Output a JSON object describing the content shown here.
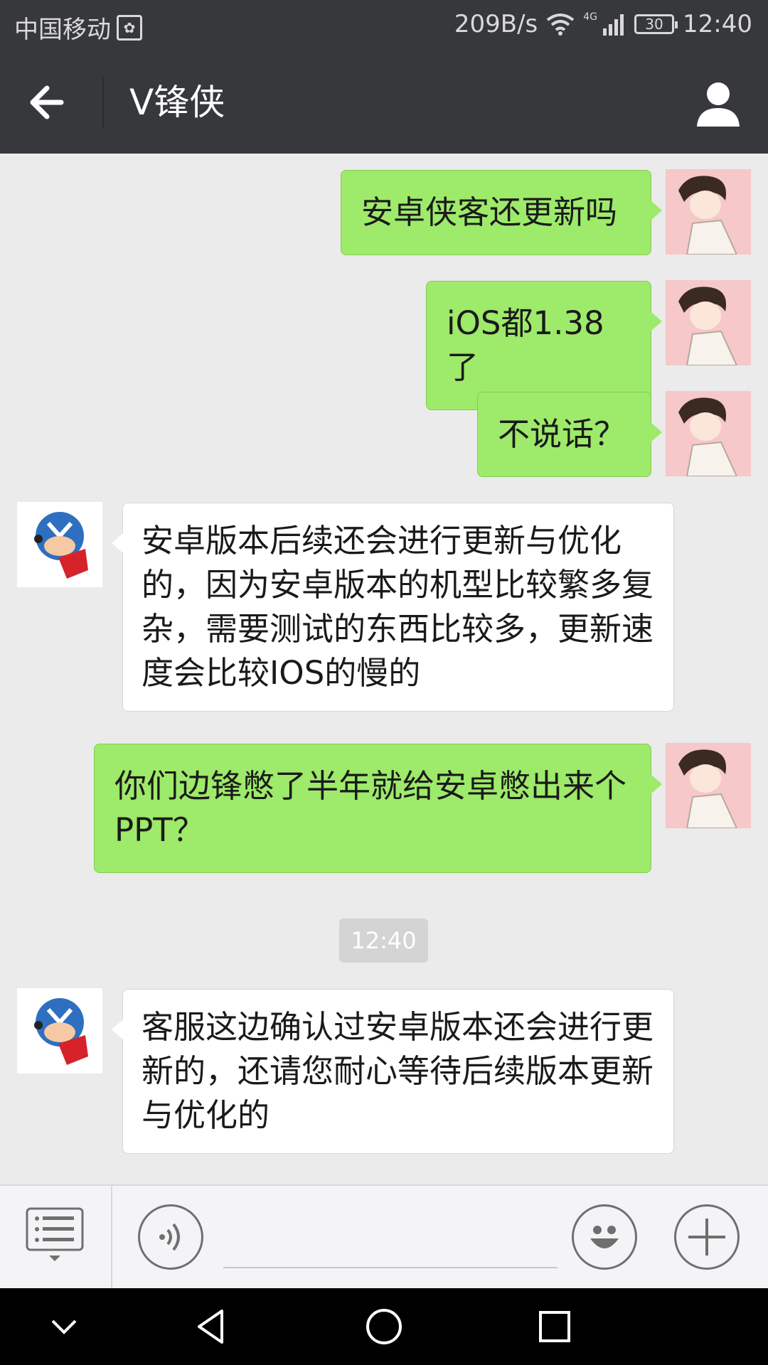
{
  "status_bar": {
    "carrier": "中国移动",
    "network_speed": "209B/s",
    "network_type": "4G",
    "battery": "30",
    "time": "12:40"
  },
  "header": {
    "title": "V锋侠"
  },
  "messages": [
    {
      "sender": "me",
      "text": "安卓侠客还更新吗"
    },
    {
      "sender": "me",
      "text": "iOS都1.38了"
    },
    {
      "sender": "me",
      "text": "不说话？"
    },
    {
      "sender": "service",
      "text": "安卓版本后续还会进行更新与优化的，因为安卓版本的机型比较繁多复杂，需要测试的东西比较多，更新速度会比较IOS的慢的"
    },
    {
      "sender": "me",
      "text": "你们边锋憋了半年就给安卓憋出来个PPT？"
    },
    {
      "sender": "service",
      "text": "客服这边确认过安卓版本还会进行更新的，还请您耐心等待后续版本更新与优化的"
    }
  ],
  "timestamp": "12:40",
  "input": {
    "value": "",
    "placeholder": ""
  },
  "colors": {
    "header_bg": "#36383c",
    "chat_bg": "#ebebeb",
    "my_bubble": "#9eea6a",
    "their_bubble": "#ffffff"
  }
}
